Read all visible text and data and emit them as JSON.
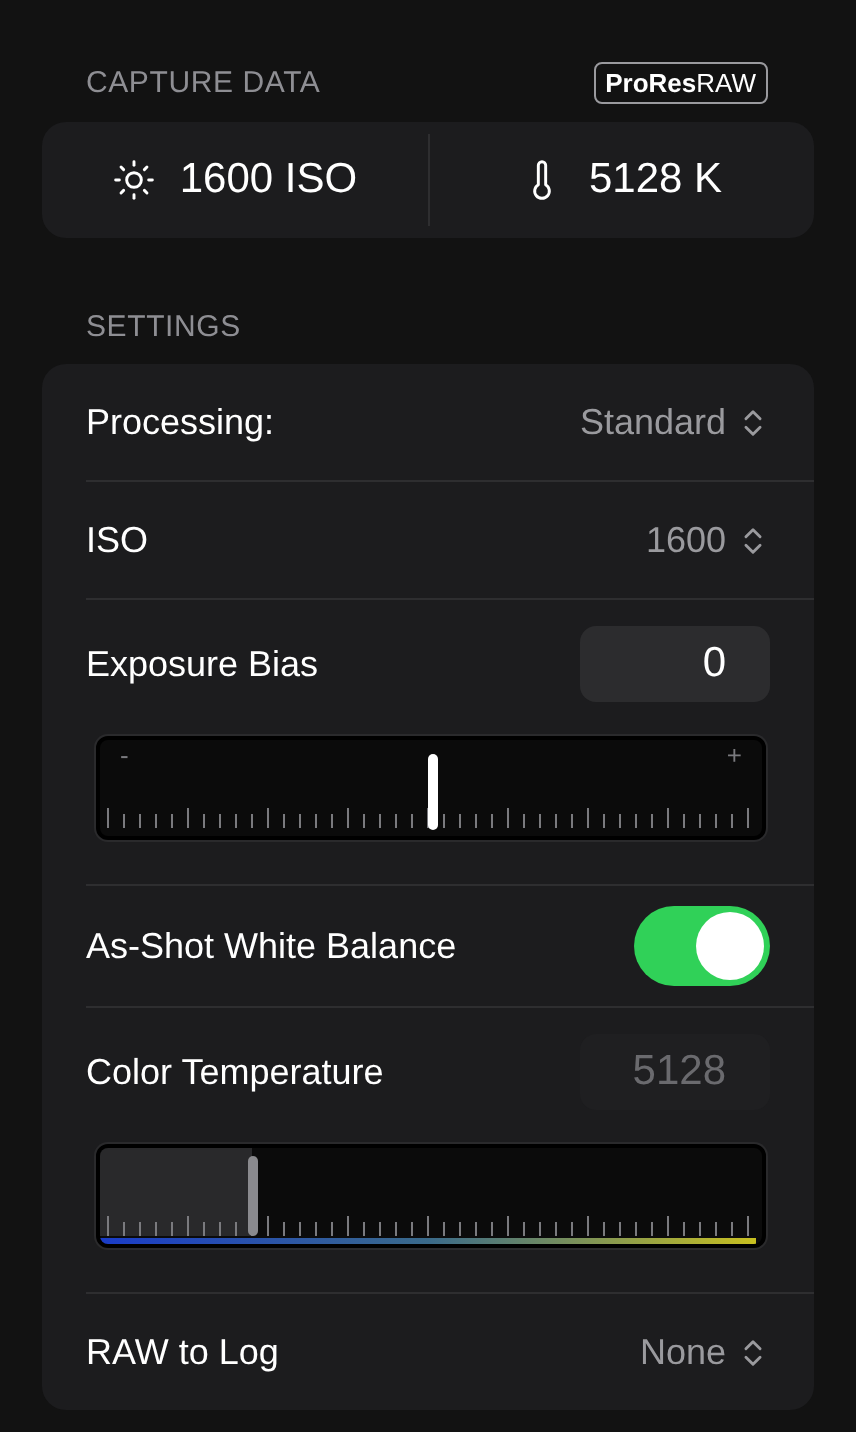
{
  "capture_data": {
    "heading": "CAPTURE DATA",
    "badge": "**ProRes**RAW",
    "iso": "1600 ISO",
    "temperature": "5128 K"
  },
  "settings": {
    "heading": "SETTINGS",
    "rows": [
      {
        "kind": "popup",
        "label": "Processing:",
        "value": "Standard"
      },
      {
        "kind": "popup",
        "label": "ISO",
        "value": "1600"
      },
      {
        "kind": "slider",
        "label": "Exposure Bias",
        "value": "0",
        "disabled": false,
        "level": 0.5,
        "color_scale": false,
        "min_label": "-",
        "max_label": "+"
      },
      {
        "kind": "toggle",
        "label": "As-Shot White Balance",
        "on": true
      },
      {
        "kind": "slider",
        "label": "Color Temperature",
        "value": "5128",
        "disabled": true,
        "level": 0.23,
        "color_scale": true
      },
      {
        "kind": "popup",
        "label": "RAW to Log",
        "value": "None"
      }
    ]
  }
}
